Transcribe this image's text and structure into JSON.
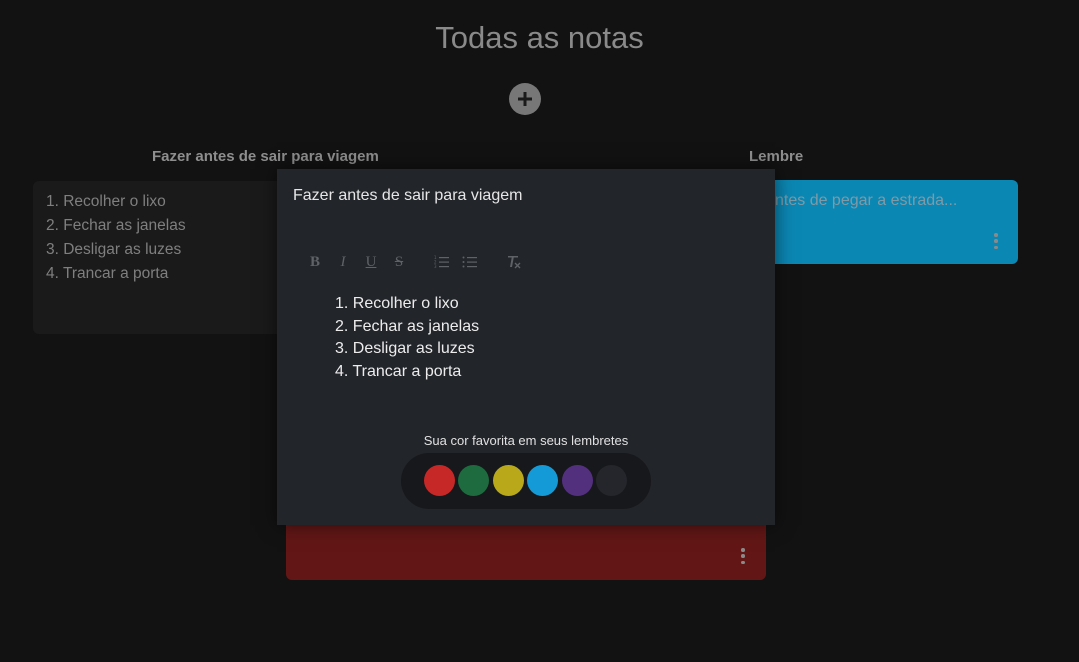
{
  "header": {
    "title": "Todas as notas"
  },
  "columns": [
    {
      "title": "Fazer antes de sair para viagem"
    },
    {
      "title": "Lembre"
    }
  ],
  "notes": {
    "list_note": {
      "items": [
        "1. Recolher o lixo",
        "2. Fechar as janelas",
        "3. Desligar as luzes",
        "4. Trancar a porta"
      ]
    },
    "reminder_note": {
      "text": "ntes de pegar a estrada...",
      "color": "#0b87b3"
    },
    "red_note": {
      "color": "#621716"
    }
  },
  "modal": {
    "title": "Fazer antes de sair para viagem",
    "toolbar": {
      "bold": "B",
      "italic": "I",
      "underline": "U",
      "strike": "S",
      "ordered_list": "ordered-list-icon",
      "bullet_list": "bullet-list-icon",
      "clear_format": "clear-format-icon"
    },
    "list_items": [
      {
        "num": "1.",
        "text": "Recolher o lixo"
      },
      {
        "num": "2.",
        "text": "Fechar as janelas"
      },
      {
        "num": "3.",
        "text": "Desligar as luzes"
      },
      {
        "num": "4.",
        "text": "Trancar a porta"
      }
    ],
    "palette": {
      "label": "Sua cor favorita em seus lembretes",
      "colors": [
        "#c62828",
        "#1e6b3f",
        "#b8a81a",
        "#149ad6",
        "#53307d",
        "#25262b"
      ]
    }
  }
}
